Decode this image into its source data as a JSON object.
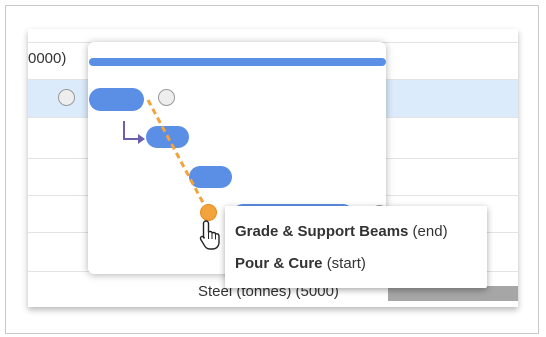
{
  "gantt": {
    "row_label_partial": "0000)",
    "bottom_row_label": "Steel (tonnes) (5000)"
  },
  "tooltip": {
    "from_task": "Grade & Support Beams",
    "from_endpoint": "(end)",
    "to_task": "Pour & Cure",
    "to_endpoint": "(start)"
  },
  "colors": {
    "task_bar": "#5b8fe6",
    "dependency_line": "#f3a33c",
    "row_highlight": "#dcebfb",
    "connector_arrow": "#6a5fb0"
  },
  "icons": {
    "cursor": "hand-pointer-icon",
    "dependency_arrow": "elbow-arrow-icon"
  }
}
